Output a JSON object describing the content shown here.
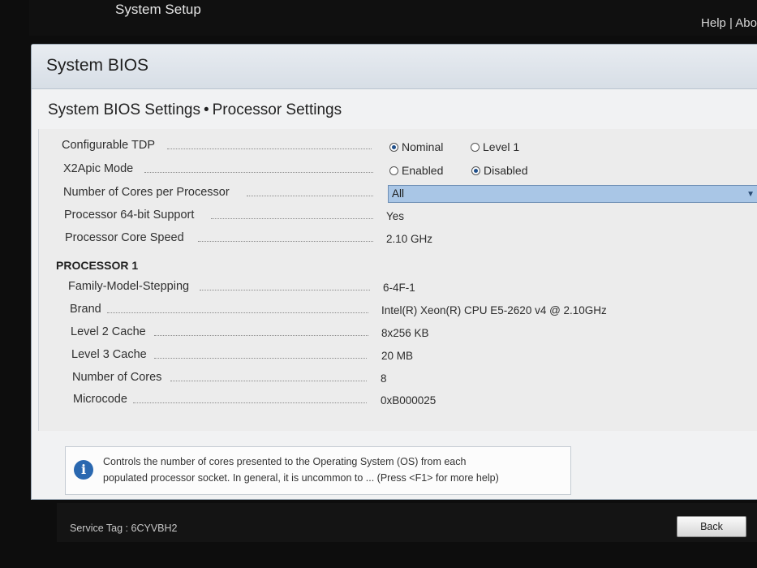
{
  "topbar": {
    "title": "System Setup",
    "help": "Help",
    "separator": "|",
    "about": "Abo"
  },
  "panel": {
    "title": "System BIOS"
  },
  "breadcrumb": {
    "parent": "System BIOS Settings",
    "separator": "•",
    "current": "Processor Settings"
  },
  "settings": {
    "configurable_tdp": {
      "label": "Configurable TDP",
      "options": [
        "Nominal",
        "Level 1"
      ],
      "selected": "Nominal"
    },
    "x2apic_mode": {
      "label": "X2Apic Mode",
      "options": [
        "Enabled",
        "Disabled"
      ],
      "selected": "Disabled"
    },
    "cores_per_processor": {
      "label": "Number of Cores per Processor",
      "value": "All"
    },
    "processor_64bit": {
      "label": "Processor 64-bit Support",
      "value": "Yes"
    },
    "core_speed": {
      "label": "Processor Core Speed",
      "value": "2.10 GHz"
    }
  },
  "processor1": {
    "heading": "PROCESSOR 1",
    "rows": [
      {
        "label": "Family-Model-Stepping",
        "value": "6-4F-1"
      },
      {
        "label": "Brand",
        "value": "Intel(R) Xeon(R) CPU E5-2620 v4 @ 2.10GHz"
      },
      {
        "label": "Level 2 Cache",
        "value": "8x256 KB"
      },
      {
        "label": "Level 3 Cache",
        "value": "20 MB"
      },
      {
        "label": "Number of Cores",
        "value": "8"
      },
      {
        "label": "Microcode",
        "value": "0xB000025"
      }
    ]
  },
  "help": {
    "line1": "Controls the number of cores presented to the Operating System (OS) from each",
    "line2": "populated processor socket. In general, it is uncommon to ... (Press <F1> for more help)"
  },
  "footer": {
    "service_tag": "Service Tag : 6CYVBH2",
    "back_label": "Back"
  },
  "colors": {
    "selection": "#a9c6e6",
    "radio_on": "#1f4f8a",
    "info_icon": "#2a68b0"
  }
}
